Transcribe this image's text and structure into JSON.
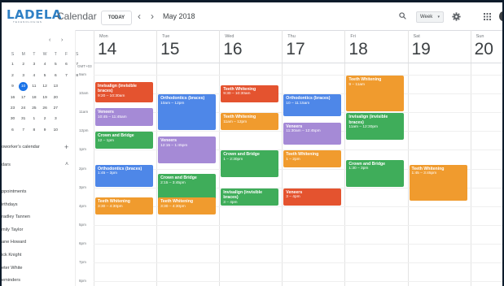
{
  "header": {
    "logo_text": "LADELA",
    "logo_sub": "TECHNOLOGIES",
    "app_title": "Calendar",
    "today_label": "TODAY",
    "prev_icon": "‹",
    "next_icon": "›",
    "month": "May 2018",
    "view": "Week",
    "view_caret": "▾"
  },
  "sidebar": {
    "mini_prev": "‹",
    "mini_next": "›",
    "weekday_headers": [
      "S",
      "M",
      "T",
      "W",
      "T",
      "F",
      "S"
    ],
    "weeks": [
      [
        "1",
        "2",
        "3",
        "4",
        "5",
        "6",
        "7"
      ],
      [
        "2",
        "3",
        "4",
        "5",
        "6",
        "7",
        "8"
      ],
      [
        "9",
        "10",
        "11",
        "12",
        "13"
      ],
      [
        "16",
        "17",
        "18",
        "19",
        "20"
      ],
      [
        "23",
        "24",
        "25",
        "26",
        "27"
      ],
      [
        "30",
        "31",
        "1",
        "2",
        "3"
      ],
      [
        "6",
        "7",
        "8",
        "9",
        "10"
      ]
    ],
    "coworker_label": "oworker's calendar",
    "add_icon": "+",
    "calendars_label": "dars",
    "collapse_icon": "˄",
    "calendars": [
      "ppointments",
      "irthdays",
      "radley Tannen",
      "mily Taylor",
      "ane Howard",
      "ick Knight",
      "eter White",
      "eminders"
    ]
  },
  "grid": {
    "timezone": "GMT+03",
    "hours": [
      "9am",
      "10am",
      "11am",
      "12pm",
      "1pm",
      "2pm",
      "3pm",
      "4pm",
      "5pm",
      "6pm",
      "7pm",
      "8pm"
    ],
    "days": [
      {
        "name": "Mon",
        "num": "14"
      },
      {
        "name": "Tue",
        "num": "15"
      },
      {
        "name": "Wed",
        "num": "16"
      },
      {
        "name": "Thu",
        "num": "17"
      },
      {
        "name": "Fri",
        "num": "18"
      },
      {
        "name": "Sat",
        "num": "19"
      },
      {
        "name": "Sun",
        "num": "20"
      }
    ]
  },
  "events": [
    {
      "day": 0,
      "start": 9.333,
      "end": 10.5,
      "title": "Invisalign (invisible braces)",
      "time": "9:20 – 10:30am",
      "color": "#e4532f"
    },
    {
      "day": 0,
      "start": 10.75,
      "end": 11.75,
      "title": "Veneers",
      "time": "10:45 – 11:45am",
      "color": "#a58ad6"
    },
    {
      "day": 0,
      "start": 12.0,
      "end": 13.0,
      "title": "Crown and Bridge",
      "time": "12 – 1pm",
      "color": "#3fad5a"
    },
    {
      "day": 0,
      "start": 13.75,
      "end": 15.0,
      "title": "Orthodontics (braces)",
      "time": "1:45 – 3pm",
      "color": "#4e87e8"
    },
    {
      "day": 0,
      "start": 15.5,
      "end": 16.5,
      "title": "Teeth Whitening",
      "time": "3:30 – 4:30pm",
      "color": "#f09b2e"
    },
    {
      "day": 1,
      "start": 10.0,
      "end": 12.0,
      "title": "Orthodontics (braces)",
      "time": "10am – 12pm",
      "color": "#4e87e8"
    },
    {
      "day": 1,
      "start": 12.25,
      "end": 13.75,
      "title": "Veneers",
      "time": "12:15 – 1:45pm",
      "color": "#a58ad6"
    },
    {
      "day": 1,
      "start": 14.25,
      "end": 15.75,
      "title": "Crown and Bridge",
      "time": "2:15 – 3:45pm",
      "color": "#3fad5a"
    },
    {
      "day": 1,
      "start": 15.5,
      "end": 16.5,
      "title": "Teeth Whitening",
      "time": "3:30 – 4:30pm",
      "color": "#f09b2e"
    },
    {
      "day": 2,
      "start": 9.5,
      "end": 10.5,
      "title": "Teeth Whitening",
      "time": "9:30 – 10:30am",
      "color": "#e4532f"
    },
    {
      "day": 2,
      "start": 11.0,
      "end": 12.0,
      "title": "Teeth Whitening",
      "time": "11am – 12pm",
      "color": "#f09b2e"
    },
    {
      "day": 2,
      "start": 13.0,
      "end": 14.5,
      "title": "Crown and Bridge",
      "time": "1 – 2:30pm",
      "color": "#3fad5a"
    },
    {
      "day": 2,
      "start": 15.0,
      "end": 16.0,
      "title": "Invisalign (invisible braces)",
      "time": "3 – 4pm",
      "color": "#3fad5a"
    },
    {
      "day": 3,
      "start": 10.0,
      "end": 11.25,
      "title": "Orthodontics (braces)",
      "time": "10 – 11:15am",
      "color": "#4e87e8"
    },
    {
      "day": 3,
      "start": 11.5,
      "end": 12.75,
      "title": "Veneers",
      "time": "11:30am – 12:45pm",
      "color": "#a58ad6"
    },
    {
      "day": 3,
      "start": 13.0,
      "end": 14.0,
      "title": "Teeth Whitening",
      "time": "1 – 2pm",
      "color": "#f09b2e"
    },
    {
      "day": 3,
      "start": 15.0,
      "end": 16.0,
      "title": "Veneers",
      "time": "3 – 4pm",
      "color": "#e4532f"
    },
    {
      "day": 4,
      "start": 9.0,
      "end": 11.0,
      "title": "Teeth Whitening",
      "time": "9 – 11am",
      "color": "#f09b2e"
    },
    {
      "day": 4,
      "start": 11.0,
      "end": 12.5,
      "title": "Invisalign (invisible braces)",
      "time": "11am – 12:30pm",
      "color": "#3fad5a"
    },
    {
      "day": 4,
      "start": 13.5,
      "end": 15.0,
      "title": "Crown and Bridge",
      "time": "1:30 – 3pm",
      "color": "#3fad5a"
    },
    {
      "day": 5,
      "start": 13.75,
      "end": 15.75,
      "title": "Teeth Whitening",
      "time": "1:45 – 3:45pm",
      "color": "#f09b2e"
    }
  ]
}
